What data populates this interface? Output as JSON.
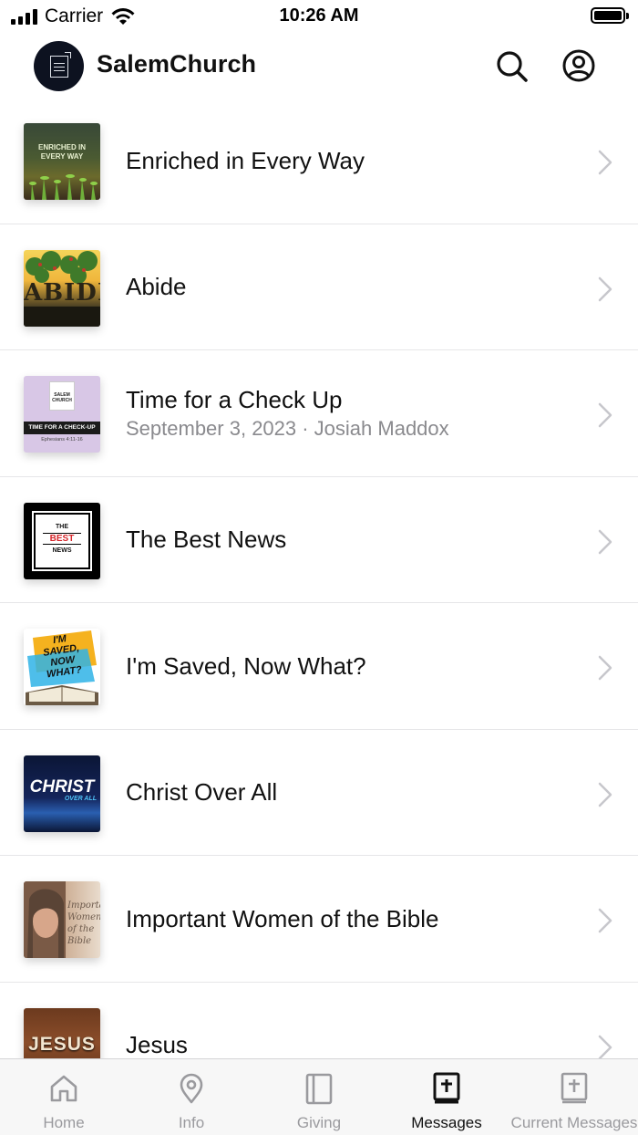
{
  "status_bar": {
    "carrier": "Carrier",
    "time": "10:26 AM",
    "battery_level": 1.0
  },
  "header": {
    "app_title": "SalemChurch",
    "icons": [
      "search-icon",
      "profile-icon"
    ]
  },
  "messages": [
    {
      "title": "Enriched in Every Way",
      "subtitle": "",
      "thumb_text": "ENRICHED IN EVERY WAY"
    },
    {
      "title": "Abide",
      "subtitle": "",
      "thumb_text": "ABIDE"
    },
    {
      "title": "Time for a Check Up",
      "subtitle": "September 3, 2023 · Josiah Maddox",
      "thumb_text": "TIME FOR A CHECK-UP",
      "thumb_sub": "Ephesians 4:11-16",
      "thumb_logo": "SALEM CHURCH"
    },
    {
      "title": "The Best News",
      "subtitle": "",
      "thumb_lines": [
        "THE",
        "BEST",
        "NEWS"
      ]
    },
    {
      "title": "I'm Saved, Now What?",
      "subtitle": "",
      "thumb_lines": [
        "I'M",
        "SAVED,",
        "NOW",
        "WHAT?"
      ]
    },
    {
      "title": "Christ Over All",
      "subtitle": "",
      "thumb_text": "CHRIST",
      "thumb_sub": "OVER ALL"
    },
    {
      "title": "Important Women of the Bible",
      "subtitle": "",
      "thumb_text": "Important Women of the Bible"
    },
    {
      "title": "Jesus",
      "subtitle": "",
      "thumb_text": "JESUS"
    }
  ],
  "tabbar": {
    "active": "Messages",
    "tabs": [
      {
        "label": "Home",
        "icon": "home-icon"
      },
      {
        "label": "Info",
        "icon": "location-pin-icon"
      },
      {
        "label": "Giving",
        "icon": "book-icon"
      },
      {
        "label": "Messages",
        "icon": "bible-icon"
      },
      {
        "label": "Current Messages",
        "icon": "bible-icon"
      }
    ]
  },
  "colors": {
    "text_primary": "#111111",
    "text_secondary": "#8a8a8e",
    "divider": "#e6e6e8",
    "tab_inactive": "#9a9a9e",
    "tab_active": "#111111"
  }
}
